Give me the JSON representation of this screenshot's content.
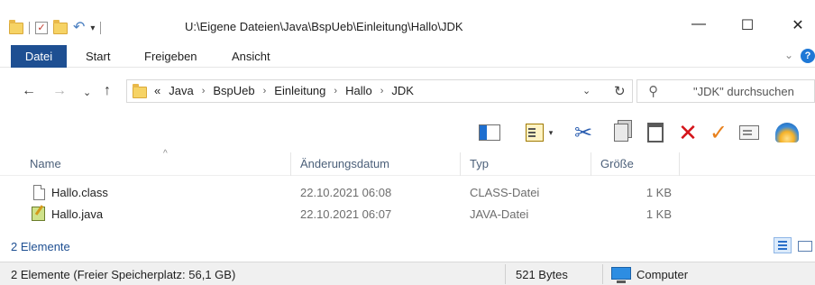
{
  "window": {
    "title": "U:\\Eigene Dateien\\Java\\BspUeb\\Einleitung\\Hallo\\JDK",
    "controls": {
      "minimize": "—",
      "maximize": "☐",
      "close": "✕"
    }
  },
  "quick_access": {
    "icons": [
      "folder-icon",
      "properties-check-icon",
      "new-folder-icon",
      "undo-icon"
    ],
    "dropdown": "▾"
  },
  "ribbon": {
    "tabs": [
      "Datei",
      "Start",
      "Freigeben",
      "Ansicht"
    ],
    "expand": "⌄",
    "help": "?"
  },
  "nav": {
    "back": "←",
    "forward": "→",
    "recent": "⌄",
    "up": "↑"
  },
  "address": {
    "overflow": "«",
    "crumbs": [
      "Java",
      "BspUeb",
      "Einleitung",
      "Hallo",
      "JDK"
    ],
    "separator": "›",
    "dropdown": "⌄",
    "refresh": "↻"
  },
  "search": {
    "placeholder": "\"JDK\" durchsuchen"
  },
  "toolbar": {
    "icons": [
      "preview-pane-icon",
      "views-icon",
      "cut-icon",
      "copy-icon",
      "paste-icon",
      "delete-icon",
      "checkmark-icon",
      "properties-icon",
      "shell-icon"
    ],
    "cut_glyph": "✂",
    "delete_glyph": "✕",
    "check_glyph": "✓",
    "dd": "▾"
  },
  "columns": {
    "name": "Name",
    "date": "Änderungsdatum",
    "type": "Typ",
    "size": "Größe",
    "sort_indicator": "^"
  },
  "files": [
    {
      "name": "Hallo.class",
      "date": "22.10.2021 06:08",
      "type": "CLASS-Datei",
      "size": "1 KB",
      "icon": "file-icon"
    },
    {
      "name": "Hallo.java",
      "date": "22.10.2021 06:07",
      "type": "JAVA-Datei",
      "size": "1 KB",
      "icon": "java-file-icon"
    }
  ],
  "item_count": "2 Elemente",
  "status": {
    "left": "2 Elemente (Freier Speicherplatz: 56,1 GB)",
    "size": "521 Bytes",
    "location": "Computer"
  },
  "colors": {
    "file_tab": "#1e4f92",
    "header_text": "#4c607a",
    "delete": "#d4141a",
    "check": "#e8801c"
  }
}
